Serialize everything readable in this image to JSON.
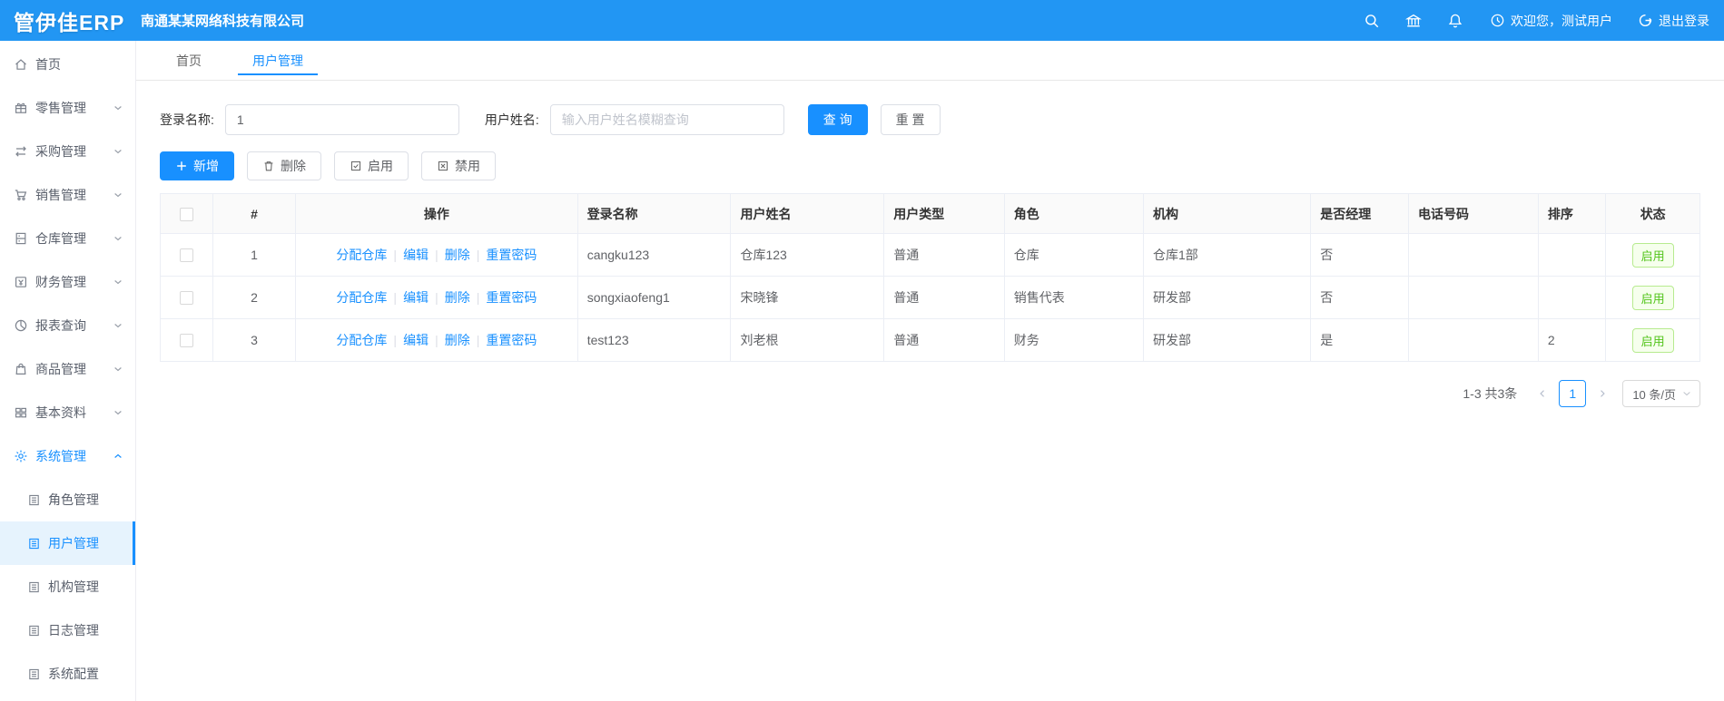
{
  "header": {
    "logo": "管伊佳ERP",
    "company": "南通某某网络科技有限公司",
    "welcome": "欢迎您，测试用户",
    "logout": "退出登录"
  },
  "sidebar": {
    "items": [
      {
        "label": "首页",
        "icon": "home-icon"
      },
      {
        "label": "零售管理",
        "icon": "gift-icon"
      },
      {
        "label": "采购管理",
        "icon": "swap-icon"
      },
      {
        "label": "销售管理",
        "icon": "cart-icon"
      },
      {
        "label": "仓库管理",
        "icon": "warehouse-icon"
      },
      {
        "label": "财务管理",
        "icon": "finance-icon"
      },
      {
        "label": "报表查询",
        "icon": "pie-chart-icon"
      },
      {
        "label": "商品管理",
        "icon": "bag-icon"
      },
      {
        "label": "基本资料",
        "icon": "grid-icon"
      },
      {
        "label": "系统管理",
        "icon": "gear-icon"
      }
    ],
    "submenu": [
      {
        "label": "角色管理"
      },
      {
        "label": "用户管理"
      },
      {
        "label": "机构管理"
      },
      {
        "label": "日志管理"
      },
      {
        "label": "系统配置"
      }
    ]
  },
  "tabs": [
    {
      "label": "首页"
    },
    {
      "label": "用户管理"
    }
  ],
  "search": {
    "login_label": "登录名称:",
    "login_value": "1",
    "name_label": "用户姓名:",
    "name_placeholder": "输入用户姓名模糊查询",
    "query_btn": "查 询",
    "reset_btn": "重 置"
  },
  "toolbar": {
    "add": "新增",
    "delete": "删除",
    "enable": "启用",
    "disable": "禁用"
  },
  "table": {
    "columns": {
      "index": "#",
      "ops": "操作",
      "login": "登录名称",
      "name": "用户姓名",
      "type": "用户类型",
      "role": "角色",
      "org": "机构",
      "manager": "是否经理",
      "phone": "电话号码",
      "sort": "排序",
      "status": "状态"
    },
    "op_labels": [
      "分配仓库",
      "编辑",
      "删除",
      "重置密码"
    ],
    "rows": [
      {
        "index": "1",
        "login": "cangku123",
        "name": "仓库123",
        "type": "普通",
        "role": "仓库",
        "org": "仓库1部",
        "manager": "否",
        "phone": "",
        "sort": "",
        "status": "启用"
      },
      {
        "index": "2",
        "login": "songxiaofeng1",
        "name": "宋晓锋",
        "type": "普通",
        "role": "销售代表",
        "org": "研发部",
        "manager": "否",
        "phone": "",
        "sort": "",
        "status": "启用"
      },
      {
        "index": "3",
        "login": "test123",
        "name": "刘老根",
        "type": "普通",
        "role": "财务",
        "org": "研发部",
        "manager": "是",
        "phone": "",
        "sort": "2",
        "status": "启用"
      }
    ]
  },
  "pagination": {
    "total": "1-3 共3条",
    "page": "1",
    "page_size": "10 条/页"
  },
  "colors": {
    "topbar": "#2296f3",
    "accent": "#1890ff",
    "status_green": "#52c41a"
  }
}
